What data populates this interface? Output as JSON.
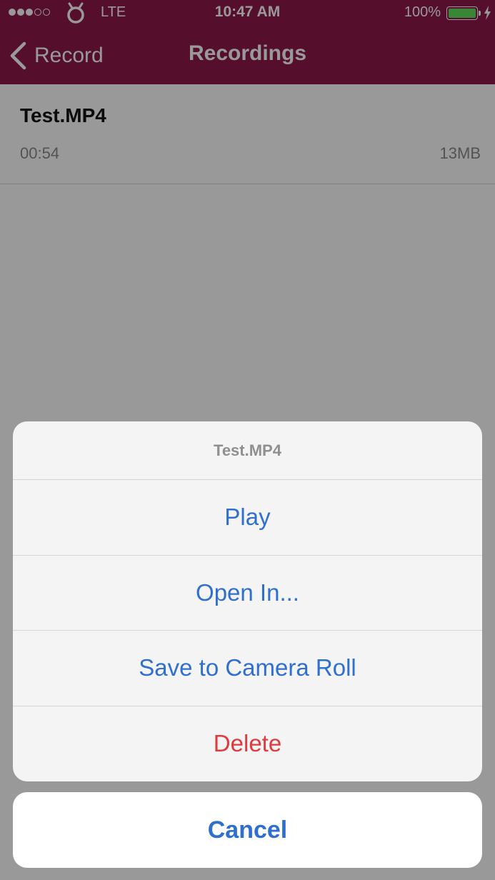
{
  "status_bar": {
    "network": "LTE",
    "time": "10:47 AM",
    "battery_percent": "100%",
    "signal_bars_filled": 3,
    "signal_bars_total": 5,
    "battery_level": 1.0
  },
  "nav": {
    "back_label": "Record",
    "title": "Recordings"
  },
  "recordings": [
    {
      "name": "Test.MP4",
      "duration": "00:54",
      "size": "13MB"
    }
  ],
  "action_sheet": {
    "title": "Test.MP4",
    "actions": [
      {
        "label": "Play"
      },
      {
        "label": "Open In..."
      },
      {
        "label": "Save to Camera Roll"
      },
      {
        "label": "Delete"
      }
    ],
    "cancel_label": "Cancel"
  },
  "colors": {
    "header_bg": "#8e1a4c",
    "action_blue": "#2f6fcf",
    "destructive_red": "#e03a3e",
    "battery_green": "#5fe15a"
  }
}
